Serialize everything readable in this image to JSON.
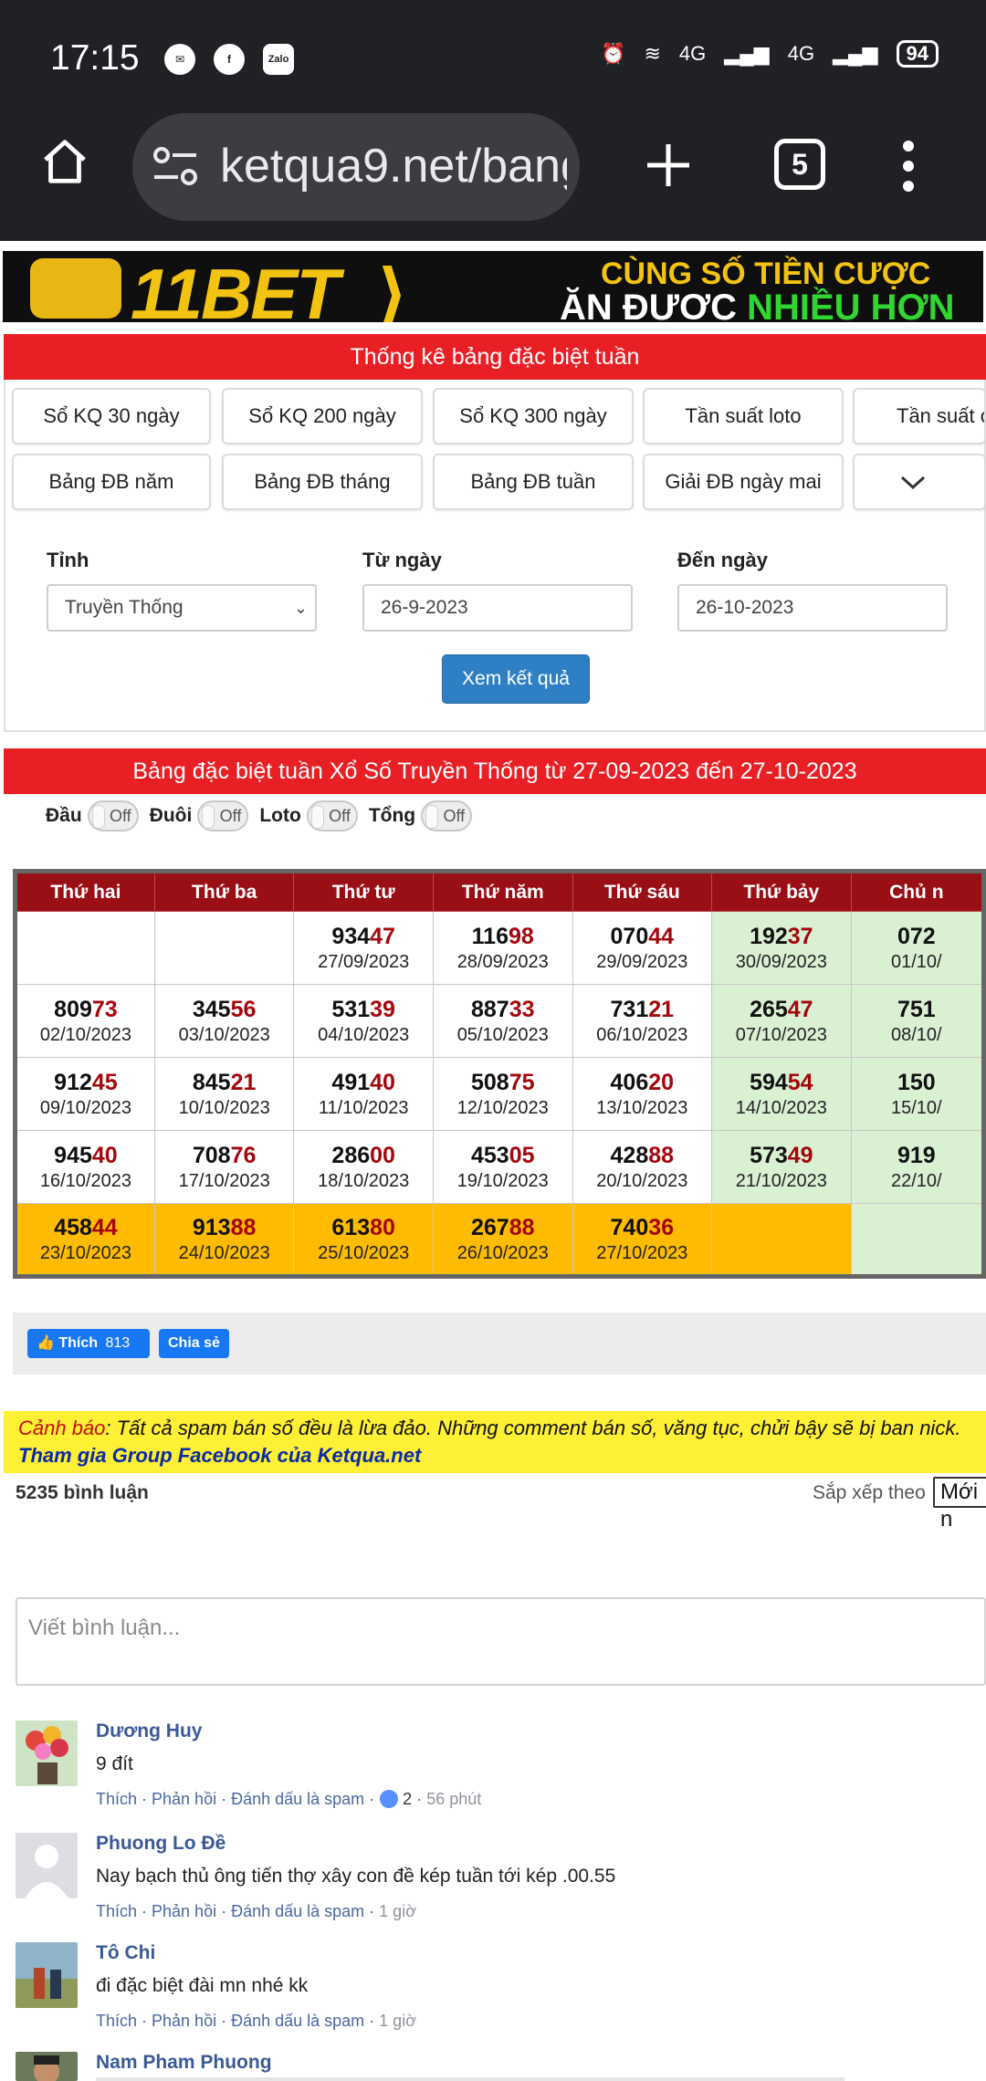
{
  "status_bar": {
    "time": "17:15",
    "network_1": "4G",
    "network_2": "4G",
    "battery": "94"
  },
  "browser": {
    "url": "ketqua9.net/bang",
    "tab_count": "5"
  },
  "ad": {
    "brand": "11BET",
    "line1": "CÙNG SỐ TIỀN CƯỢC",
    "line2a": "ĂN ĐƯỢC",
    "line2b": "NHIỀU HƠN"
  },
  "header": {
    "title": "Thống kê bảng đặc biệt tuần"
  },
  "nav": {
    "row1": [
      "Sổ KQ 30 ngày",
      "Sổ KQ 200 ngày",
      "Sổ KQ 300 ngày",
      "Tần suất loto",
      "Tần suất c"
    ],
    "row2": [
      "Bảng ĐB năm",
      "Bảng ĐB tháng",
      "Bảng ĐB tuần",
      "Giải ĐB ngày mai"
    ]
  },
  "form": {
    "province_label": "Tỉnh",
    "province_value": "Truyền Thống",
    "from_label": "Từ ngày",
    "from_value": "26-9-2023",
    "to_label": "Đến ngày",
    "to_value": "26-10-2023",
    "submit": "Xem kết quả"
  },
  "result": {
    "title": "Bảng đặc biệt tuần Xổ Số Truyền Thống từ 27-09-2023 đến 27-10-2023",
    "toggles": [
      {
        "label": "Đầu",
        "state": "Off"
      },
      {
        "label": "Đuôi",
        "state": "Off"
      },
      {
        "label": "Loto",
        "state": "Off"
      },
      {
        "label": "Tổng",
        "state": "Off"
      }
    ],
    "days": [
      "Thứ hai",
      "Thứ ba",
      "Thứ tư",
      "Thứ năm",
      "Thứ sáu",
      "Thứ bảy",
      "Chủ n"
    ],
    "rows": [
      [
        {
          "head": "",
          "tail": "",
          "date": ""
        },
        {
          "head": "",
          "tail": "",
          "date": ""
        },
        {
          "head": "934",
          "tail": "47",
          "date": "27/09/2023"
        },
        {
          "head": "116",
          "tail": "98",
          "date": "28/09/2023"
        },
        {
          "head": "070",
          "tail": "44",
          "date": "29/09/2023"
        },
        {
          "head": "192",
          "tail": "37",
          "date": "30/09/2023"
        },
        {
          "head": "072",
          "tail": "",
          "date": "01/10/"
        }
      ],
      [
        {
          "head": "809",
          "tail": "73",
          "date": "02/10/2023"
        },
        {
          "head": "345",
          "tail": "56",
          "date": "03/10/2023"
        },
        {
          "head": "531",
          "tail": "39",
          "date": "04/10/2023"
        },
        {
          "head": "887",
          "tail": "33",
          "date": "05/10/2023"
        },
        {
          "head": "731",
          "tail": "21",
          "date": "06/10/2023"
        },
        {
          "head": "265",
          "tail": "47",
          "date": "07/10/2023"
        },
        {
          "head": "751",
          "tail": "",
          "date": "08/10/"
        }
      ],
      [
        {
          "head": "912",
          "tail": "45",
          "date": "09/10/2023"
        },
        {
          "head": "845",
          "tail": "21",
          "date": "10/10/2023"
        },
        {
          "head": "491",
          "tail": "40",
          "date": "11/10/2023"
        },
        {
          "head": "508",
          "tail": "75",
          "date": "12/10/2023"
        },
        {
          "head": "406",
          "tail": "20",
          "date": "13/10/2023"
        },
        {
          "head": "594",
          "tail": "54",
          "date": "14/10/2023"
        },
        {
          "head": "150",
          "tail": "",
          "date": "15/10/"
        }
      ],
      [
        {
          "head": "945",
          "tail": "40",
          "date": "16/10/2023"
        },
        {
          "head": "708",
          "tail": "76",
          "date": "17/10/2023"
        },
        {
          "head": "286",
          "tail": "00",
          "date": "18/10/2023"
        },
        {
          "head": "453",
          "tail": "05",
          "date": "19/10/2023"
        },
        {
          "head": "428",
          "tail": "88",
          "date": "20/10/2023"
        },
        {
          "head": "573",
          "tail": "49",
          "date": "21/10/2023"
        },
        {
          "head": "919",
          "tail": "",
          "date": "22/10/"
        }
      ],
      [
        {
          "head": "458",
          "tail": "44",
          "date": "23/10/2023"
        },
        {
          "head": "913",
          "tail": "88",
          "date": "24/10/2023"
        },
        {
          "head": "613",
          "tail": "80",
          "date": "25/10/2023"
        },
        {
          "head": "267",
          "tail": "88",
          "date": "26/10/2023"
        },
        {
          "head": "740",
          "tail": "36",
          "date": "27/10/2023"
        },
        {
          "head": "",
          "tail": "",
          "date": ""
        },
        {
          "head": "",
          "tail": "",
          "date": ""
        }
      ]
    ]
  },
  "social": {
    "like_label": "Thích",
    "like_count": "813",
    "share_label": "Chia sẻ"
  },
  "warning": {
    "prefix": "Cảnh báo",
    "text": ": Tất cả spam bán số đều là lừa đảo. Những comment bán số, văng tục, chửi bậy sẽ bị ban nick.",
    "group_link": "Tham gia Group Facebook của Ketqua.net"
  },
  "comments_meta": {
    "count": "5235 bình luận",
    "sort_label": "Sắp xếp theo",
    "sort_value": "Mới n"
  },
  "comment_box": {
    "placeholder": "Viết bình luận..."
  },
  "comments": [
    {
      "name": "Dương Huy",
      "text": "9 đít",
      "actions": "Thích · Phản hồi · Đánh dấu là spam ·",
      "likes": "2",
      "time": "56 phút"
    },
    {
      "name": "Phuong Lo Đề",
      "text": "Nay bạch thủ ông tiến thợ xây con đề kép tuần tới kép .00.55",
      "actions": "Thích · Phản hồi · Đánh dấu là spam ·",
      "time": "1 giờ"
    },
    {
      "name": "Tô Chi",
      "text": "đi đặc biệt đài mn nhé kk",
      "actions": "Thích · Phản hồi · Đánh dấu là spam ·",
      "time": "1 giờ"
    },
    {
      "name": "Nam Pham Phuong"
    }
  ]
}
